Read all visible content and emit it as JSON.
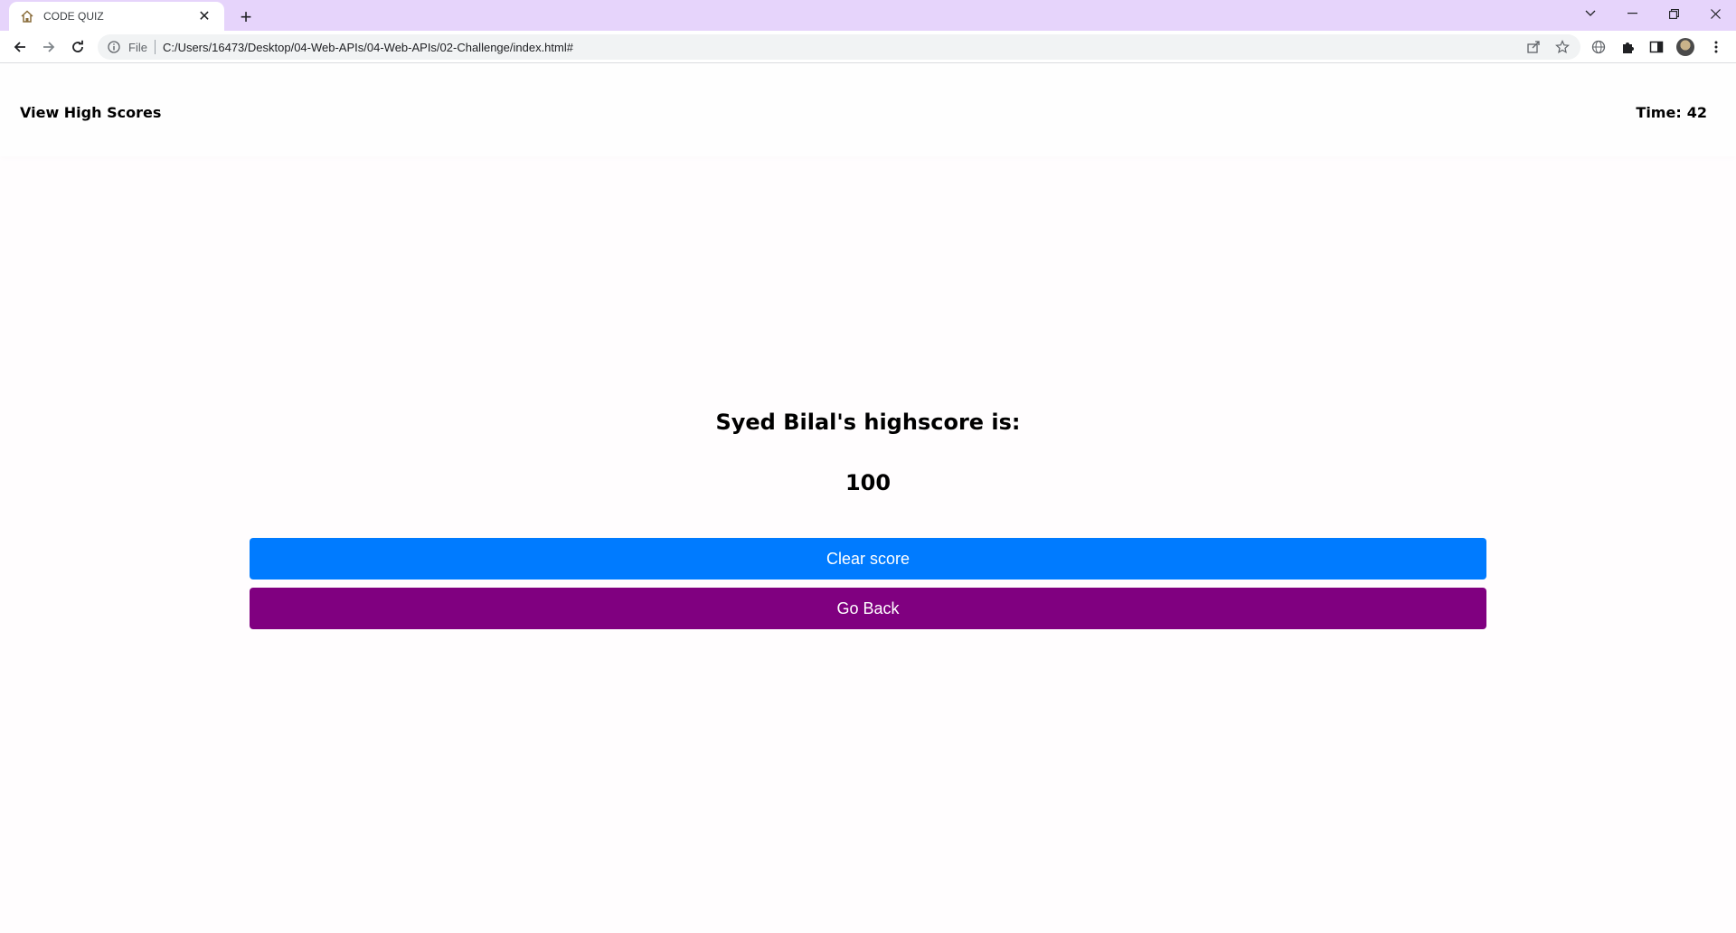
{
  "browser": {
    "tab_title": "CODE QUIZ",
    "new_tab_symbol": "+",
    "close_symbol": "✕",
    "address_scheme_label": "File",
    "address_url": "C:/Users/16473/Desktop/04-Web-APIs/04-Web-APIs/02-Challenge/index.html#",
    "icons": [
      "house-favicon-icon",
      "back-arrow-icon",
      "forward-arrow-icon",
      "reload-icon",
      "info-icon",
      "share-icon",
      "star-icon",
      "extension-globe-icon",
      "puzzle-icon",
      "side-panel-icon",
      "avatar",
      "more-menu-icon",
      "tab-search-icon",
      "minimize-icon",
      "restore-icon",
      "close-window-icon"
    ],
    "tabstrip_color": "#e6d4fb"
  },
  "header": {
    "view_high_scores": "View High Scores",
    "time_label": "Time:",
    "time_value": "42"
  },
  "main": {
    "score_title": "Syed Bilal's highscore is:",
    "score_value": "100",
    "clear_button": "Clear score",
    "back_button": "Go Back",
    "clear_color": "#007bff",
    "back_color": "#800080"
  }
}
